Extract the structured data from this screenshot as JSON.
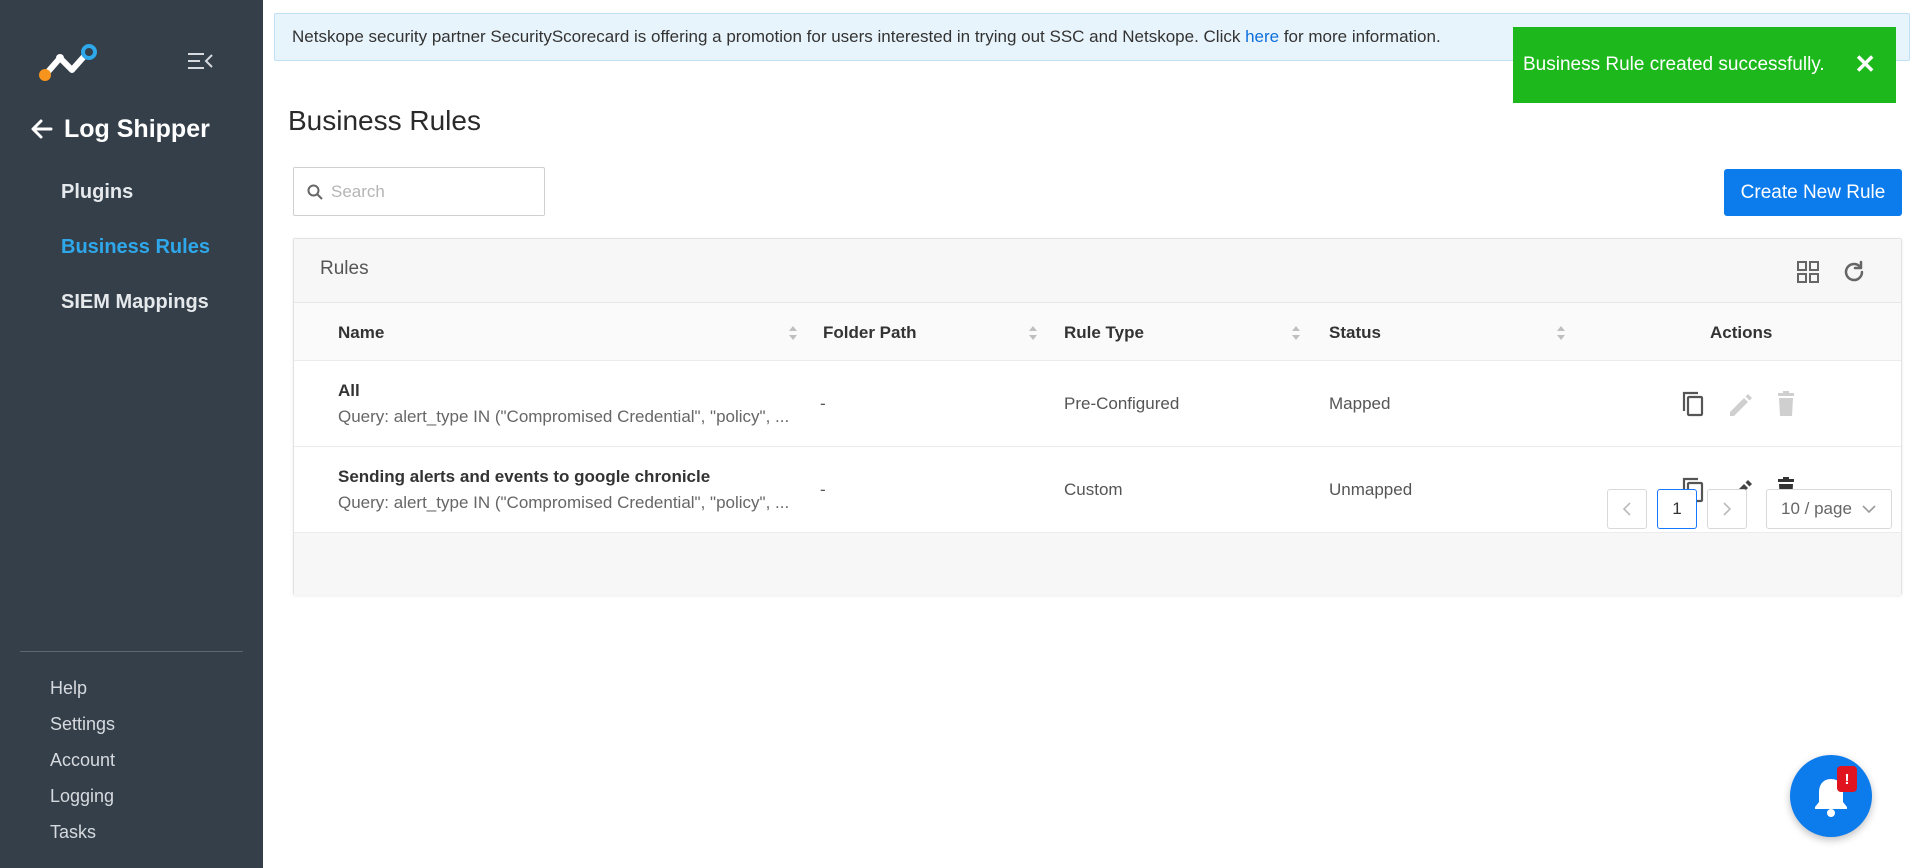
{
  "sidebar": {
    "back_label": "Log Shipper",
    "items": [
      {
        "label": "Plugins"
      },
      {
        "label": "Business Rules"
      },
      {
        "label": "SIEM Mappings"
      }
    ],
    "footer_links": [
      {
        "label": "Help"
      },
      {
        "label": "Settings"
      },
      {
        "label": "Account"
      },
      {
        "label": "Logging"
      },
      {
        "label": "Tasks"
      }
    ]
  },
  "banner": {
    "text_before": "Netskope security partner SecurityScorecard is offering a promotion for users interested in trying out SSC and Netskope. Click ",
    "link": "here",
    "text_after": " for more information."
  },
  "toast": {
    "message": "Business Rule created successfully.",
    "close": "✕"
  },
  "page": {
    "title": "Business Rules",
    "search_placeholder": "Search",
    "create_button": "Create New Rule"
  },
  "card": {
    "title": "Rules"
  },
  "table": {
    "columns": [
      "Name",
      "Folder Path",
      "Rule Type",
      "Status",
      "Actions"
    ],
    "rows": [
      {
        "name": "All",
        "query": "Query: alert_type IN (\"Compromised Credential\", \"policy\", ...",
        "folder": "-",
        "type": "Pre-Configured",
        "status": "Mapped"
      },
      {
        "name": "Sending alerts and events to google chronicle",
        "query": "Query: alert_type IN (\"Compromised Credential\", \"policy\", ...",
        "folder": "-",
        "type": "Custom",
        "status": "Unmapped"
      }
    ]
  },
  "pagination": {
    "current": "1",
    "page_size": "10 / page"
  },
  "notification_badge": "!",
  "colors": {
    "sidebar_bg": "#343f4a",
    "active_nav": "#2ea8ea",
    "primary": "#0c7bec",
    "toast_green": "#1cb81c"
  }
}
